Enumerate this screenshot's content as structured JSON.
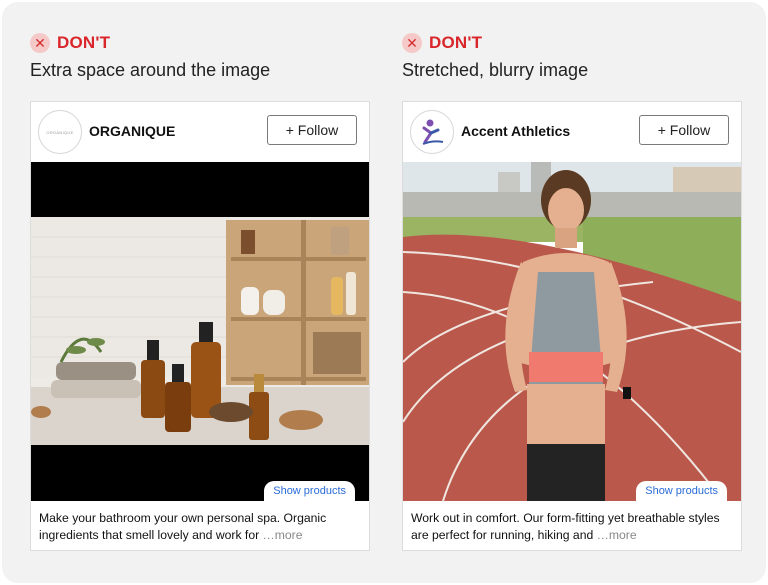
{
  "examples": [
    {
      "badge": "DON'T",
      "subtitle": "Extra space around the image",
      "brand": "ORGANIQUE",
      "avatar_text": "ORGANIQUE",
      "follow_label": "+ Follow",
      "show_products": "Show products",
      "caption": "Make your bathroom your own personal spa. Organic ingredients that smell lovely and work for",
      "more": "…more",
      "icon": "spa-products-photo"
    },
    {
      "badge": "DON'T",
      "subtitle": "Stretched, blurry image",
      "brand": "Accent Athletics",
      "follow_label": "+ Follow",
      "show_products": "Show products",
      "caption": "Work out in comfort. Our form-fitting yet breathable styles are perfect for running, hiking and",
      "more": "…more",
      "icon": "runner-photo"
    }
  ],
  "colors": {
    "dont_red": "#d9262b",
    "link_blue": "#2a6bd6"
  }
}
